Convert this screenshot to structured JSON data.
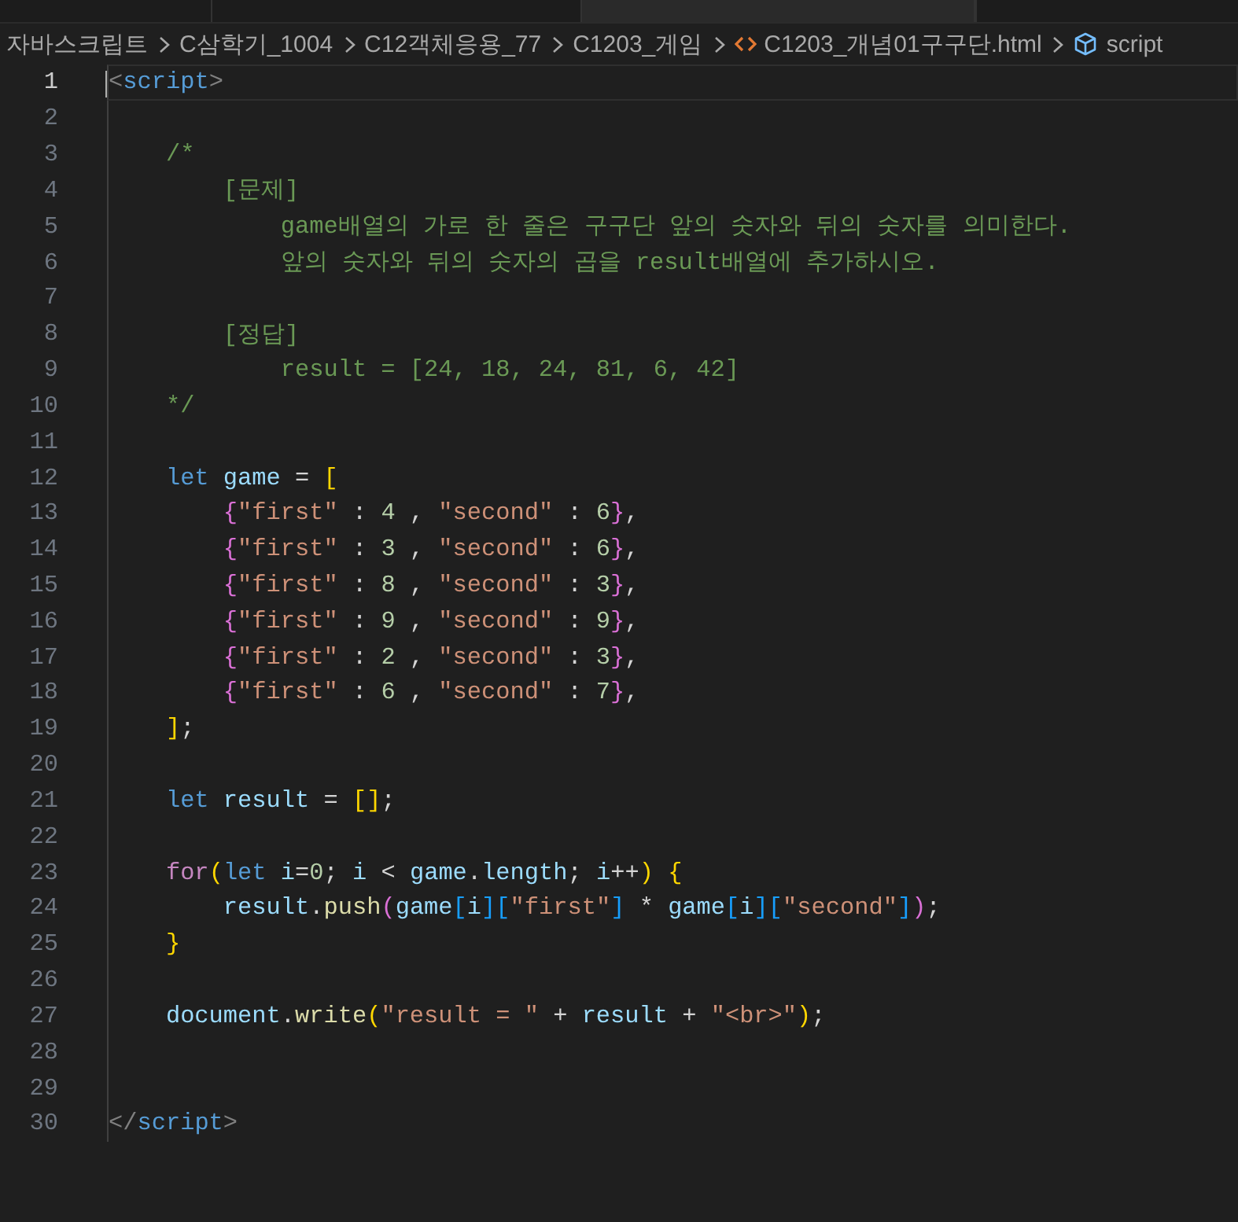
{
  "tabs": [
    {
      "selected": false
    },
    {
      "selected": false
    },
    {
      "selected": true
    },
    {
      "selected": false
    }
  ],
  "breadcrumb": [
    {
      "kind": "folder",
      "label": "자바스크립트"
    },
    {
      "kind": "folder",
      "label": "C삼학기_1004"
    },
    {
      "kind": "folder",
      "label": "C12객체응용_77"
    },
    {
      "kind": "folder",
      "label": "C1203_게임"
    },
    {
      "kind": "file",
      "label": "C1203_개념01구구단.html"
    },
    {
      "kind": "symbol",
      "label": "script"
    }
  ],
  "lines": [
    {
      "number": "1",
      "current": true,
      "tokens": [
        {
          "kind": "punct",
          "text": "<"
        },
        {
          "kind": "tag",
          "text": "script"
        },
        {
          "kind": "punct",
          "text": ">"
        }
      ]
    },
    {
      "number": "2",
      "current": false
    },
    {
      "number": "3",
      "current": false,
      "tokens": [
        {
          "kind": "comment",
          "text": "    /*"
        }
      ]
    },
    {
      "number": "4",
      "current": false,
      "tokens": [
        {
          "kind": "comment",
          "text": "        [문제]"
        }
      ]
    },
    {
      "number": "5",
      "current": false,
      "tokens": [
        {
          "kind": "comment",
          "text": "            game배열의 가로 한 줄은 구구단 앞의 숫자와 뒤의 숫자를 의미한다."
        }
      ]
    },
    {
      "number": "6",
      "current": false,
      "tokens": [
        {
          "kind": "comment",
          "text": "            앞의 숫자와 뒤의 숫자의 곱을 result배열에 추가하시오."
        }
      ]
    },
    {
      "number": "7",
      "current": false
    },
    {
      "number": "8",
      "current": false,
      "tokens": [
        {
          "kind": "comment",
          "text": "        [정답]"
        }
      ]
    },
    {
      "number": "9",
      "current": false,
      "tokens": [
        {
          "kind": "comment",
          "text": "            result = [24, 18, 24, 81, 6, 42]"
        }
      ]
    },
    {
      "number": "10",
      "current": false,
      "tokens": [
        {
          "kind": "comment",
          "text": "    */"
        }
      ]
    },
    {
      "number": "11",
      "current": false
    },
    {
      "number": "12",
      "current": false,
      "tokens": [
        {
          "kind": "keyword",
          "text": "    let"
        },
        {
          "kind": "var",
          "text": " game"
        },
        {
          "kind": "plain",
          "text": " = "
        },
        {
          "kind": "bracket-gold",
          "text": "["
        }
      ]
    },
    {
      "number": "13",
      "current": false,
      "tokens": [
        {
          "kind": "bracket-pink",
          "text": "        {"
        },
        {
          "kind": "string",
          "text": "\"first\""
        },
        {
          "kind": "plain",
          "text": " : "
        },
        {
          "kind": "number",
          "text": "4"
        },
        {
          "kind": "plain",
          "text": " , "
        },
        {
          "kind": "string",
          "text": "\"second\""
        },
        {
          "kind": "plain",
          "text": " : "
        },
        {
          "kind": "number",
          "text": "6"
        },
        {
          "kind": "bracket-pink",
          "text": "}"
        },
        {
          "kind": "plain",
          "text": ","
        }
      ]
    },
    {
      "number": "14",
      "current": false,
      "tokens": [
        {
          "kind": "bracket-pink",
          "text": "        {"
        },
        {
          "kind": "string",
          "text": "\"first\""
        },
        {
          "kind": "plain",
          "text": " : "
        },
        {
          "kind": "number",
          "text": "3"
        },
        {
          "kind": "plain",
          "text": " , "
        },
        {
          "kind": "string",
          "text": "\"second\""
        },
        {
          "kind": "plain",
          "text": " : "
        },
        {
          "kind": "number",
          "text": "6"
        },
        {
          "kind": "bracket-pink",
          "text": "}"
        },
        {
          "kind": "plain",
          "text": ","
        }
      ]
    },
    {
      "number": "15",
      "current": false,
      "tokens": [
        {
          "kind": "bracket-pink",
          "text": "        {"
        },
        {
          "kind": "string",
          "text": "\"first\""
        },
        {
          "kind": "plain",
          "text": " : "
        },
        {
          "kind": "number",
          "text": "8"
        },
        {
          "kind": "plain",
          "text": " , "
        },
        {
          "kind": "string",
          "text": "\"second\""
        },
        {
          "kind": "plain",
          "text": " : "
        },
        {
          "kind": "number",
          "text": "3"
        },
        {
          "kind": "bracket-pink",
          "text": "}"
        },
        {
          "kind": "plain",
          "text": ","
        }
      ]
    },
    {
      "number": "16",
      "current": false,
      "tokens": [
        {
          "kind": "bracket-pink",
          "text": "        {"
        },
        {
          "kind": "string",
          "text": "\"first\""
        },
        {
          "kind": "plain",
          "text": " : "
        },
        {
          "kind": "number",
          "text": "9"
        },
        {
          "kind": "plain",
          "text": " , "
        },
        {
          "kind": "string",
          "text": "\"second\""
        },
        {
          "kind": "plain",
          "text": " : "
        },
        {
          "kind": "number",
          "text": "9"
        },
        {
          "kind": "bracket-pink",
          "text": "}"
        },
        {
          "kind": "plain",
          "text": ","
        }
      ]
    },
    {
      "number": "17",
      "current": false,
      "tokens": [
        {
          "kind": "bracket-pink",
          "text": "        {"
        },
        {
          "kind": "string",
          "text": "\"first\""
        },
        {
          "kind": "plain",
          "text": " : "
        },
        {
          "kind": "number",
          "text": "2"
        },
        {
          "kind": "plain",
          "text": " , "
        },
        {
          "kind": "string",
          "text": "\"second\""
        },
        {
          "kind": "plain",
          "text": " : "
        },
        {
          "kind": "number",
          "text": "3"
        },
        {
          "kind": "bracket-pink",
          "text": "}"
        },
        {
          "kind": "plain",
          "text": ","
        }
      ]
    },
    {
      "number": "18",
      "current": false,
      "tokens": [
        {
          "kind": "bracket-pink",
          "text": "        {"
        },
        {
          "kind": "string",
          "text": "\"first\""
        },
        {
          "kind": "plain",
          "text": " : "
        },
        {
          "kind": "number",
          "text": "6"
        },
        {
          "kind": "plain",
          "text": " , "
        },
        {
          "kind": "string",
          "text": "\"second\""
        },
        {
          "kind": "plain",
          "text": " : "
        },
        {
          "kind": "number",
          "text": "7"
        },
        {
          "kind": "bracket-pink",
          "text": "}"
        },
        {
          "kind": "plain",
          "text": ","
        }
      ]
    },
    {
      "number": "19",
      "current": false,
      "tokens": [
        {
          "kind": "bracket-gold",
          "text": "    ]"
        },
        {
          "kind": "plain",
          "text": ";"
        }
      ]
    },
    {
      "number": "20",
      "current": false
    },
    {
      "number": "21",
      "current": false,
      "tokens": [
        {
          "kind": "keyword",
          "text": "    let"
        },
        {
          "kind": "var",
          "text": " result"
        },
        {
          "kind": "plain",
          "text": " = "
        },
        {
          "kind": "bracket-gold",
          "text": "[]"
        },
        {
          "kind": "plain",
          "text": ";"
        }
      ]
    },
    {
      "number": "22",
      "current": false
    },
    {
      "number": "23",
      "current": false,
      "tokens": [
        {
          "kind": "control",
          "text": "    for"
        },
        {
          "kind": "bracket-gold",
          "text": "("
        },
        {
          "kind": "keyword",
          "text": "let"
        },
        {
          "kind": "var",
          "text": " i"
        },
        {
          "kind": "plain",
          "text": "="
        },
        {
          "kind": "number",
          "text": "0"
        },
        {
          "kind": "plain",
          "text": "; "
        },
        {
          "kind": "var",
          "text": "i"
        },
        {
          "kind": "plain",
          "text": " < "
        },
        {
          "kind": "var",
          "text": "game"
        },
        {
          "kind": "plain",
          "text": "."
        },
        {
          "kind": "var",
          "text": "length"
        },
        {
          "kind": "plain",
          "text": "; "
        },
        {
          "kind": "var",
          "text": "i"
        },
        {
          "kind": "plain",
          "text": "++"
        },
        {
          "kind": "bracket-gold",
          "text": ")"
        },
        {
          "kind": "bracket-gold",
          "text": " {"
        }
      ]
    },
    {
      "number": "24",
      "current": false,
      "tokens": [
        {
          "kind": "var",
          "text": "        result"
        },
        {
          "kind": "plain",
          "text": "."
        },
        {
          "kind": "func",
          "text": "push"
        },
        {
          "kind": "bracket-pink",
          "text": "("
        },
        {
          "kind": "var",
          "text": "game"
        },
        {
          "kind": "bracket-blue",
          "text": "["
        },
        {
          "kind": "var",
          "text": "i"
        },
        {
          "kind": "bracket-blue",
          "text": "]["
        },
        {
          "kind": "string",
          "text": "\"first\""
        },
        {
          "kind": "bracket-blue",
          "text": "]"
        },
        {
          "kind": "plain",
          "text": " * "
        },
        {
          "kind": "var",
          "text": "game"
        },
        {
          "kind": "bracket-blue",
          "text": "["
        },
        {
          "kind": "var",
          "text": "i"
        },
        {
          "kind": "bracket-blue",
          "text": "]["
        },
        {
          "kind": "string",
          "text": "\"second\""
        },
        {
          "kind": "bracket-blue",
          "text": "]"
        },
        {
          "kind": "bracket-pink",
          "text": ")"
        },
        {
          "kind": "plain",
          "text": ";"
        }
      ]
    },
    {
      "number": "25",
      "current": false,
      "tokens": [
        {
          "kind": "bracket-gold",
          "text": "    }"
        }
      ]
    },
    {
      "number": "26",
      "current": false
    },
    {
      "number": "27",
      "current": false,
      "tokens": [
        {
          "kind": "var",
          "text": "    document"
        },
        {
          "kind": "plain",
          "text": "."
        },
        {
          "kind": "func",
          "text": "write"
        },
        {
          "kind": "bracket-gold",
          "text": "("
        },
        {
          "kind": "string",
          "text": "\"result = \""
        },
        {
          "kind": "plain",
          "text": " + "
        },
        {
          "kind": "var",
          "text": "result"
        },
        {
          "kind": "plain",
          "text": " + "
        },
        {
          "kind": "string",
          "text": "\"<br>\""
        },
        {
          "kind": "bracket-gold",
          "text": ")"
        },
        {
          "kind": "plain",
          "text": ";"
        }
      ]
    },
    {
      "number": "28",
      "current": false
    },
    {
      "number": "29",
      "current": false
    },
    {
      "number": "30",
      "current": false,
      "tokens": [
        {
          "kind": "punct",
          "text": "</"
        },
        {
          "kind": "tag",
          "text": "script"
        },
        {
          "kind": "punct",
          "text": ">"
        }
      ]
    }
  ]
}
